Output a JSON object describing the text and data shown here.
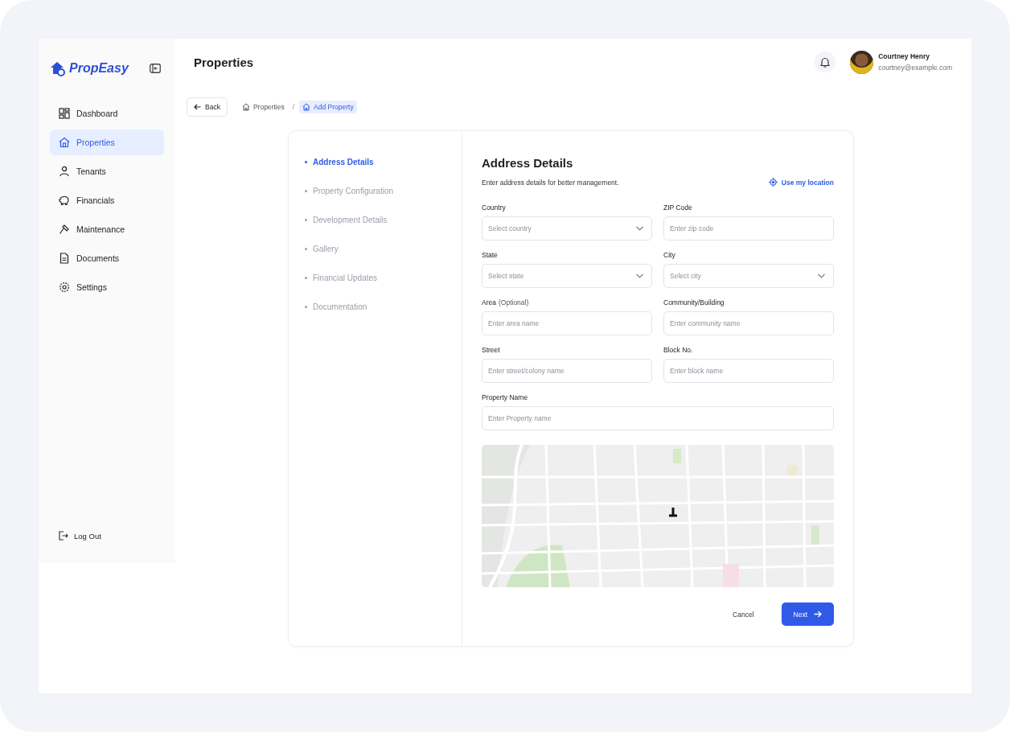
{
  "brand": {
    "name": "PropEasy"
  },
  "sidebar": {
    "items": [
      {
        "label": "Dashboard",
        "selected": false
      },
      {
        "label": "Properties",
        "selected": true
      },
      {
        "label": "Tenants",
        "selected": false
      },
      {
        "label": "Financials",
        "selected": false
      },
      {
        "label": "Maintenance",
        "selected": false
      },
      {
        "label": "Documents",
        "selected": false
      },
      {
        "label": "Settings",
        "selected": false
      }
    ],
    "logout": "Log Out"
  },
  "header": {
    "title": "Properties",
    "user": {
      "name": "Courtney Henry",
      "email": "courtney@example.com"
    }
  },
  "breadcrumb": {
    "back": "Back",
    "items": [
      {
        "label": "Properties",
        "selected": false
      },
      {
        "label": "Add Property",
        "selected": true
      }
    ],
    "separator": "/"
  },
  "steps": [
    {
      "label": "Address Details",
      "selected": true
    },
    {
      "label": "Property Configuration",
      "selected": false
    },
    {
      "label": "Development Details",
      "selected": false
    },
    {
      "label": "Gallery",
      "selected": false
    },
    {
      "label": "Financial Updates",
      "selected": false
    },
    {
      "label": "Documentation",
      "selected": false
    }
  ],
  "form": {
    "title": "Address Details",
    "subtitle": "Enter address details for better management.",
    "location_link": "Use my location",
    "fields": [
      {
        "kind": "select",
        "label": "Country",
        "placeholder": "Select country"
      },
      {
        "kind": "text",
        "label": "ZIP Code",
        "placeholder": "Enter zip code"
      },
      {
        "kind": "select",
        "label": "State",
        "placeholder": "Select state"
      },
      {
        "kind": "select",
        "label": "City",
        "placeholder": "Select city"
      },
      {
        "kind": "text",
        "label": "Area",
        "note": "(Optional)",
        "placeholder": "Enter area name"
      },
      {
        "kind": "text",
        "label": "Community/Building",
        "placeholder": "Enter community name"
      },
      {
        "kind": "text",
        "label": "Street",
        "placeholder": "Enter street/colony name"
      },
      {
        "kind": "text",
        "label": "Block No.",
        "placeholder": "Enter block name"
      },
      {
        "kind": "wide",
        "label": "Property Name",
        "placeholder": "Enter Property name"
      }
    ],
    "cancel": "Cancel",
    "next": "Next"
  }
}
